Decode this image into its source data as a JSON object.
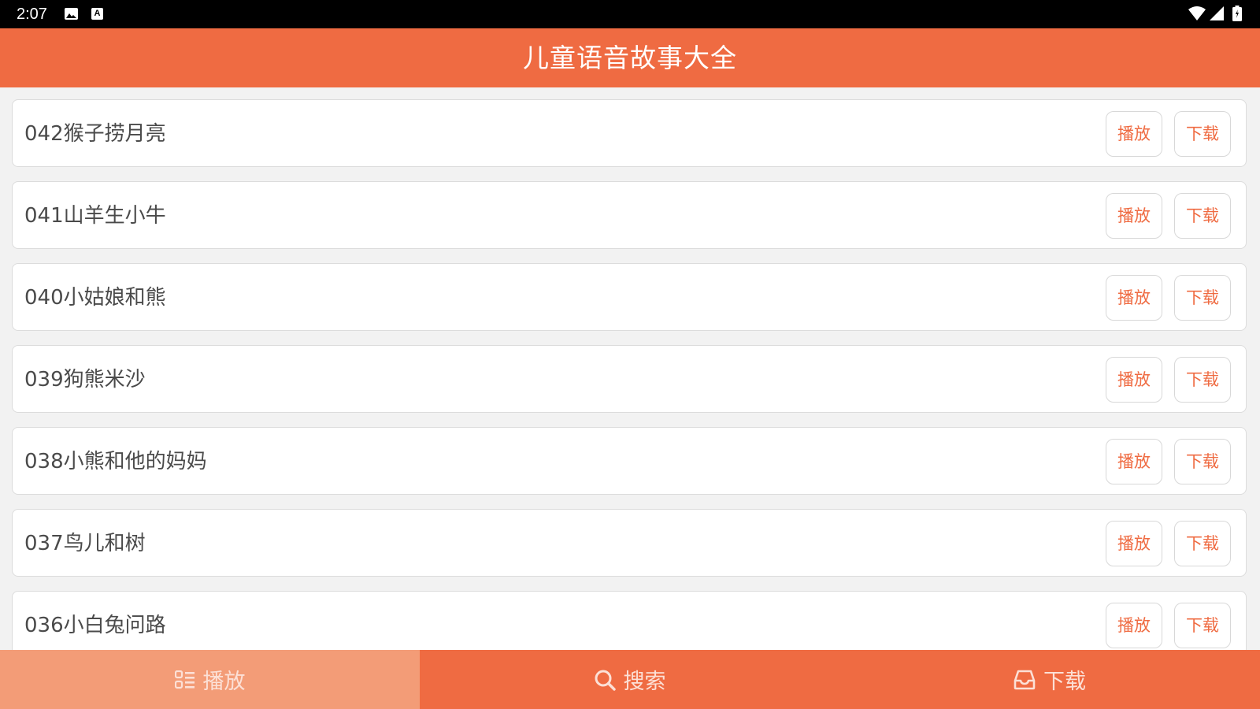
{
  "status_bar": {
    "time": "2:07",
    "icons": [
      "image-icon",
      "a-icon",
      "wifi-icon",
      "signal-icon",
      "battery-icon"
    ],
    "a_icon_text": "A"
  },
  "header": {
    "title": "儿童语音故事大全",
    "background": "#ef6b42"
  },
  "stories": [
    {
      "title": "042猴子捞月亮",
      "play_label": "播放",
      "download_label": "下载"
    },
    {
      "title": "041山羊生小牛",
      "play_label": "播放",
      "download_label": "下载"
    },
    {
      "title": "040小姑娘和熊",
      "play_label": "播放",
      "download_label": "下载"
    },
    {
      "title": "039狗熊米沙",
      "play_label": "播放",
      "download_label": "下载"
    },
    {
      "title": "038小熊和他的妈妈",
      "play_label": "播放",
      "download_label": "下载"
    },
    {
      "title": "037鸟儿和树",
      "play_label": "播放",
      "download_label": "下载"
    },
    {
      "title": "036小白兔问路",
      "play_label": "播放",
      "download_label": "下载"
    }
  ],
  "bottom_nav": {
    "tabs": [
      {
        "label": "播放",
        "icon": "list-icon",
        "active": true
      },
      {
        "label": "搜索",
        "icon": "search-icon",
        "active": false
      },
      {
        "label": "下载",
        "icon": "inbox-icon",
        "active": false
      }
    ]
  },
  "colors": {
    "accent": "#ef6b42",
    "active_tab": "#f39c77",
    "button_text": "#ef6b42"
  }
}
